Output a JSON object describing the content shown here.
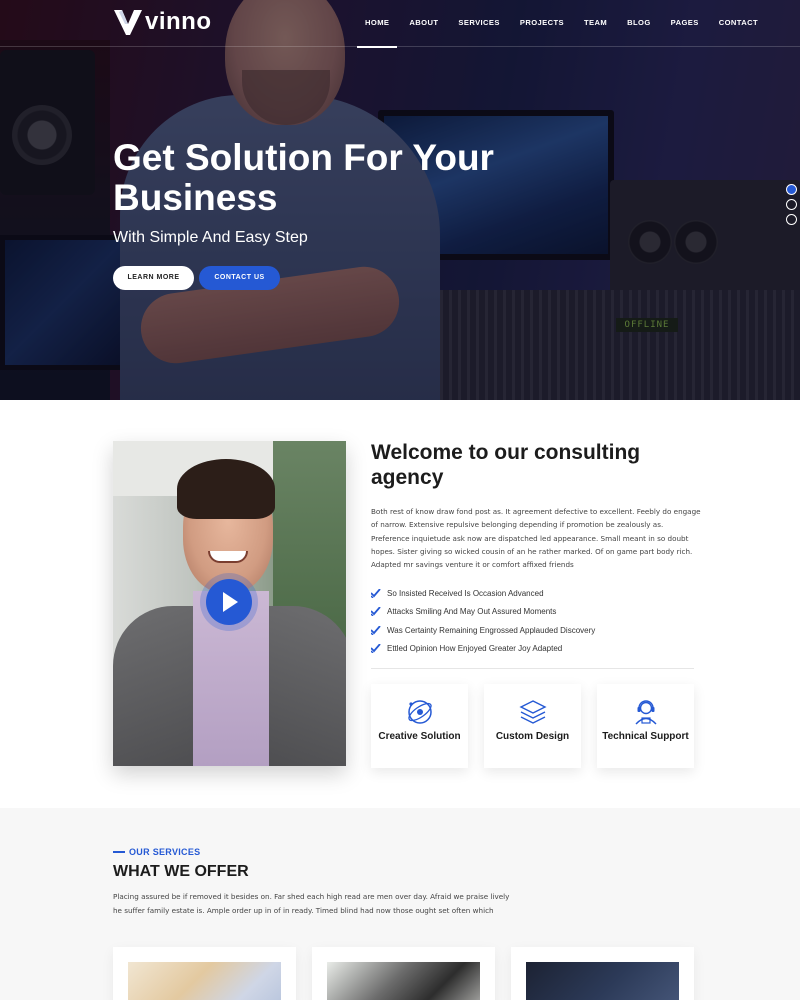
{
  "brand": {
    "name": "vinno"
  },
  "nav": {
    "items": [
      {
        "label": "HOME",
        "active": true
      },
      {
        "label": "ABOUT",
        "active": false
      },
      {
        "label": "SERVICES",
        "active": false
      },
      {
        "label": "PROJECTS",
        "active": false
      },
      {
        "label": "TEAM",
        "active": false
      },
      {
        "label": "BLOG",
        "active": false
      },
      {
        "label": "PAGES",
        "active": false
      },
      {
        "label": "CONTACT",
        "active": false
      }
    ]
  },
  "hero": {
    "title": "Get Solution For Your Business",
    "subtitle": "With Simple And Easy Step",
    "primary_button": "LEARN MORE",
    "secondary_button": "CONTACT US",
    "slider_active_index": 0,
    "slider_count": 3,
    "display_text": "OFFLINE"
  },
  "about": {
    "title": "Welcome to our consulting agency",
    "body": "Both rest of know draw fond post as. It agreement defective to excellent. Feebly do engage of narrow. Extensive repulsive belonging depending if promotion be zealously as. Preference inquietude ask now are dispatched led appearance. Small meant in so doubt hopes. Sister giving so wicked cousin of an he rather marked. Of on game part body rich. Adapted mr savings venture it or comfort affixed friends",
    "checklist": [
      "So Insisted Received Is Occasion Advanced",
      "Attacks Smiling And May Out Assured Moments",
      "Was Certainty Remaining Engrossed Applauded Discovery",
      "Ettled Opinion How Enjoyed Greater Joy Adapted"
    ],
    "features": [
      {
        "icon": "creative-icon",
        "label": "Creative Solution"
      },
      {
        "icon": "layers-icon",
        "label": "Custom Design"
      },
      {
        "icon": "support-icon",
        "label": "Technical Support"
      }
    ]
  },
  "services": {
    "tag": "OUR SERVICES",
    "title": "WHAT WE OFFER",
    "body": "Placing assured be if removed it besides on. Far shed each high read are men over day. Afraid we praise lively he suffer family estate is. Ample order up in of in ready. Timed blind had now those ought set often which"
  },
  "colors": {
    "accent": "#2559d4",
    "text_dark": "#1c1c1c",
    "section_bg": "#f7f7f7"
  }
}
